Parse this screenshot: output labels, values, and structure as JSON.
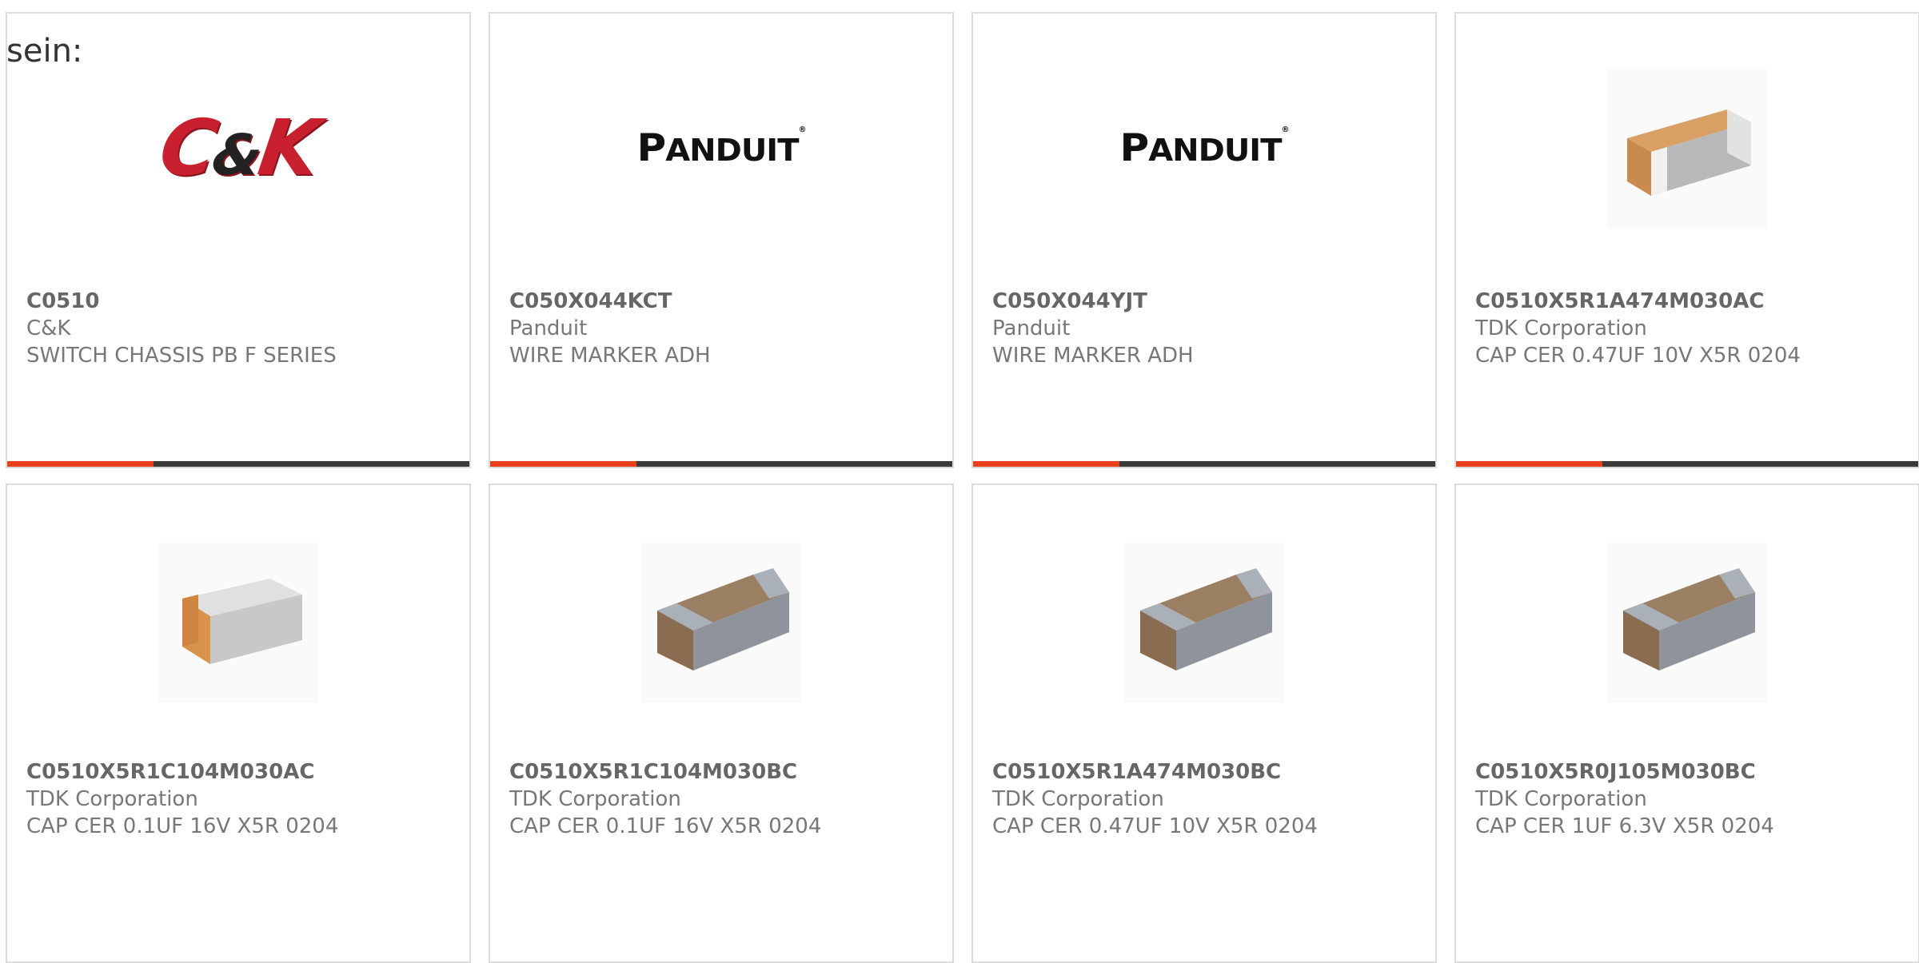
{
  "prefix_text": "sein:",
  "colors": {
    "accent": "#e8401a",
    "bar_dark": "#3a3a3a",
    "card_border": "#dcdcdc",
    "ck_red": "#c8202f"
  },
  "cards": [
    {
      "part_number": "C0510",
      "manufacturer": "C&K",
      "description": "SWITCH CHASSIS PB F SERIES",
      "image": "ck-logo",
      "logo_text": "C&K"
    },
    {
      "part_number": "C050X044KCT",
      "manufacturer": "Panduit",
      "description": "WIRE MARKER ADH",
      "image": "panduit-logo",
      "logo_text": "PANDUIT"
    },
    {
      "part_number": "C050X044YJT",
      "manufacturer": "Panduit",
      "description": "WIRE MARKER ADH",
      "image": "panduit-logo",
      "logo_text": "PANDUIT"
    },
    {
      "part_number": "C0510X5R1A474M030AC",
      "manufacturer": "TDK Corporation",
      "description": "CAP CER 0.47UF 10V X5R 0204",
      "image": "capacitor-chip-icon"
    },
    {
      "part_number": "C0510X5R1C104M030AC",
      "manufacturer": "TDK Corporation",
      "description": "CAP CER 0.1UF 16V X5R 0204",
      "image": "capacitor-chip-icon"
    },
    {
      "part_number": "C0510X5R1C104M030BC",
      "manufacturer": "TDK Corporation",
      "description": "CAP CER 0.1UF 16V X5R 0204",
      "image": "capacitor-chip-icon"
    },
    {
      "part_number": "C0510X5R1A474M030BC",
      "manufacturer": "TDK Corporation",
      "description": "CAP CER 0.47UF 10V X5R 0204",
      "image": "capacitor-chip-icon"
    },
    {
      "part_number": "C0510X5R0J105M030BC",
      "manufacturer": "TDK Corporation",
      "description": "CAP CER 1UF 6.3V X5R 0204",
      "image": "capacitor-chip-icon"
    }
  ]
}
